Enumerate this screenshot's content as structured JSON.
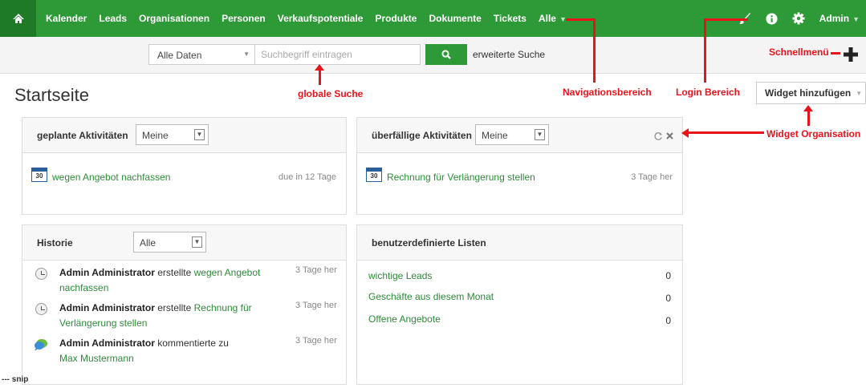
{
  "nav": {
    "items": [
      "Kalender",
      "Leads",
      "Organisationen",
      "Personen",
      "Verkaufspotentiale",
      "Produkte",
      "Dokumente",
      "Tickets",
      "Alle"
    ],
    "admin": "Admin"
  },
  "search": {
    "filter": "Alle Daten",
    "placeholder": "Suchbegriff eintragen",
    "extended": "erweiterte Suche"
  },
  "page": {
    "title": "Startseite",
    "widget_button": "Widget hinzufügen"
  },
  "annotations": {
    "schnellmenu": "Schnellmenü",
    "global_search": "globale Suche",
    "nav_area": "Navigationsbereich",
    "login_area": "Login Bereich",
    "widget_org": "Widget Organisation"
  },
  "panels": {
    "planned": {
      "title": "geplante Aktivitäten",
      "filter": "Meine",
      "item": "wegen Angebot nachfassen",
      "due": "due in 12 Tage",
      "cal_day": "30"
    },
    "overdue": {
      "title": "überfällige Aktivitäten",
      "filter": "Meine",
      "item": "Rechnung für Verlängerung stellen",
      "age": "3 Tage her",
      "cal_day": "30"
    },
    "history": {
      "title": "Historie",
      "filter": "Alle",
      "entries": [
        {
          "user": "Admin Administrator",
          "action": "erstellte",
          "link": "wegen Angebot nachfassen",
          "time": "3 Tage her"
        },
        {
          "user": "Admin Administrator",
          "action": "erstellte",
          "link": "Rechnung für Verlängerung stellen",
          "time": "3 Tage her"
        },
        {
          "user": "Admin Administrator",
          "action": "kommentierte zu",
          "link": "Max Mustermann",
          "time": "3 Tage her"
        }
      ]
    },
    "lists": {
      "title": "benutzerdefinierte Listen",
      "items": [
        {
          "label": "wichtige Leads",
          "count": "0"
        },
        {
          "label": "Geschäfte aus diesem Monat",
          "count": "0"
        },
        {
          "label": "Offene Angebote",
          "count": "0"
        }
      ]
    }
  },
  "footer": {
    "snip": "--- snip"
  },
  "colors": {
    "nav_green": "#2e9a37",
    "annotation_red": "#e8141a",
    "link_green": "#2e8b3a"
  }
}
